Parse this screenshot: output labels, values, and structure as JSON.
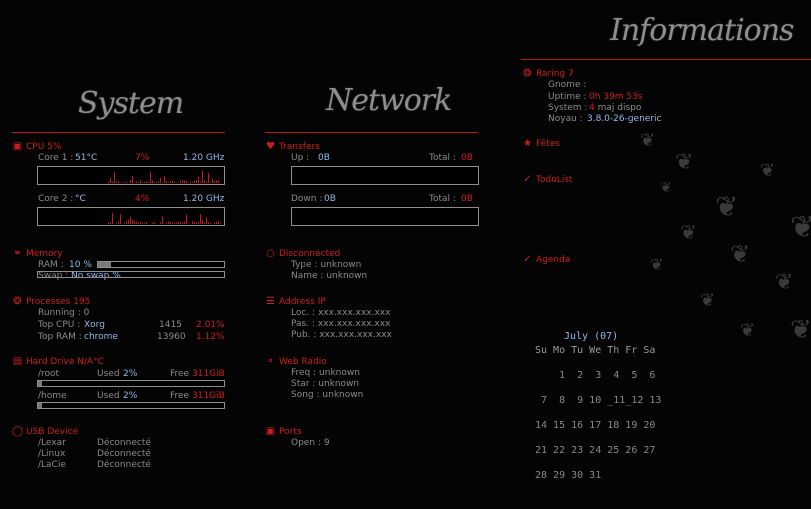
{
  "headings": {
    "system": "System",
    "network": "Network",
    "info": "Informations"
  },
  "system": {
    "cpu": {
      "label": "CPU 5%",
      "cores": [
        {
          "name": "Core 1 :",
          "temp": "51°C",
          "pct": "7%",
          "freq": "1.20 GHz"
        },
        {
          "name": "Core 2 :",
          "temp": "°C",
          "pct": "4%",
          "freq": "1.20 GHz"
        }
      ]
    },
    "memory": {
      "label": "Memory",
      "ram_label": "RAM  :",
      "ram_value": "10 %",
      "ram_fraction": 0.1,
      "swap_label": "Swap :",
      "swap_value": "No swap %"
    },
    "processes": {
      "label": "Processes 195",
      "running_label": "Running :",
      "running_value": "0",
      "top_cpu_label": "Top CPU :",
      "top_cpu_name": "Xorg",
      "top_cpu_pid": "1415",
      "top_cpu_pct": "2.01%",
      "top_ram_label": "Top RAM :",
      "top_ram_name": "chrome",
      "top_ram_pid": "13960",
      "top_ram_pct": "1.12%"
    },
    "hdd": {
      "label": "Hard Drive N/A°C",
      "drives": [
        {
          "mount": "/root",
          "used_label": "Used",
          "used": "2%",
          "free_label": "Free",
          "free": "311GiB",
          "fraction": 0.02
        },
        {
          "mount": "/home",
          "used_label": "Used",
          "used": "2%",
          "free_label": "Free",
          "free": "311GiB",
          "fraction": 0.02
        }
      ]
    },
    "usb": {
      "label": "USB Device",
      "devices": [
        {
          "name": "/Lexar",
          "status": "Déconnecté"
        },
        {
          "name": "/Linux",
          "status": "Déconnecté"
        },
        {
          "name": "/LaCie",
          "status": "Déconnecté"
        }
      ]
    }
  },
  "network": {
    "transfers": {
      "label": "Transfers",
      "up_label": "Up   :",
      "up_value": "0B",
      "up_total_label": "Total :",
      "up_total": "0B",
      "down_label": "Down :",
      "down_value": "0B",
      "down_total_label": "Total :",
      "down_total": "0B"
    },
    "connection": {
      "label": "Disconnected",
      "type_label": "Type :",
      "type_value": "unknown",
      "name_label": "Name :",
      "name_value": "unknown"
    },
    "ip": {
      "label": "Address IP",
      "loc_label": "Loc. :",
      "loc": "xxx.xxx.xxx.xxx",
      "pas_label": "Pas. :",
      "pas": "xxx.xxx.xxx.xxx",
      "pub_label": "Pub. :",
      "pub": "xxx.xxx.xxx.xxx"
    },
    "radio": {
      "label": "Web Radio",
      "freq_label": "Freq :",
      "freq": "unknown",
      "star_label": "Star :",
      "star": "unknown",
      "song_label": "Song :",
      "song": "unknown"
    },
    "ports": {
      "label": "Ports",
      "open_label": "Open :",
      "open": "9"
    }
  },
  "info": {
    "system_label": "Raring 7",
    "gnome_label": "Gnome :",
    "gnome_value": "",
    "uptime_label": "Uptime :",
    "uptime_value": "0h 39m 53s",
    "system_row_label": "System :",
    "system_updates": "4",
    "system_updates_text": "maj dispo",
    "kernel_label": "Noyau :",
    "kernel_value": "3.8.0-26-generic",
    "fetes_label": "Fêtes",
    "todo_label": "TodoList",
    "agenda_label": "Agenda"
  },
  "calendar": {
    "title": "July (07)",
    "weekdays": "Su Mo Tu We Th Fr Sa",
    "weeks": [
      "    1  2  3  4  5  6",
      " 7  8  9 10 _11_12 13",
      "14 15 16 17 18 19 20",
      "21 22 23 24 25 26 27",
      "28 29 30 31"
    ]
  },
  "colors": {
    "accent": "#d01c1c",
    "value": "#8fb8e8",
    "text": "#8a8a8a",
    "background": "#040404"
  }
}
